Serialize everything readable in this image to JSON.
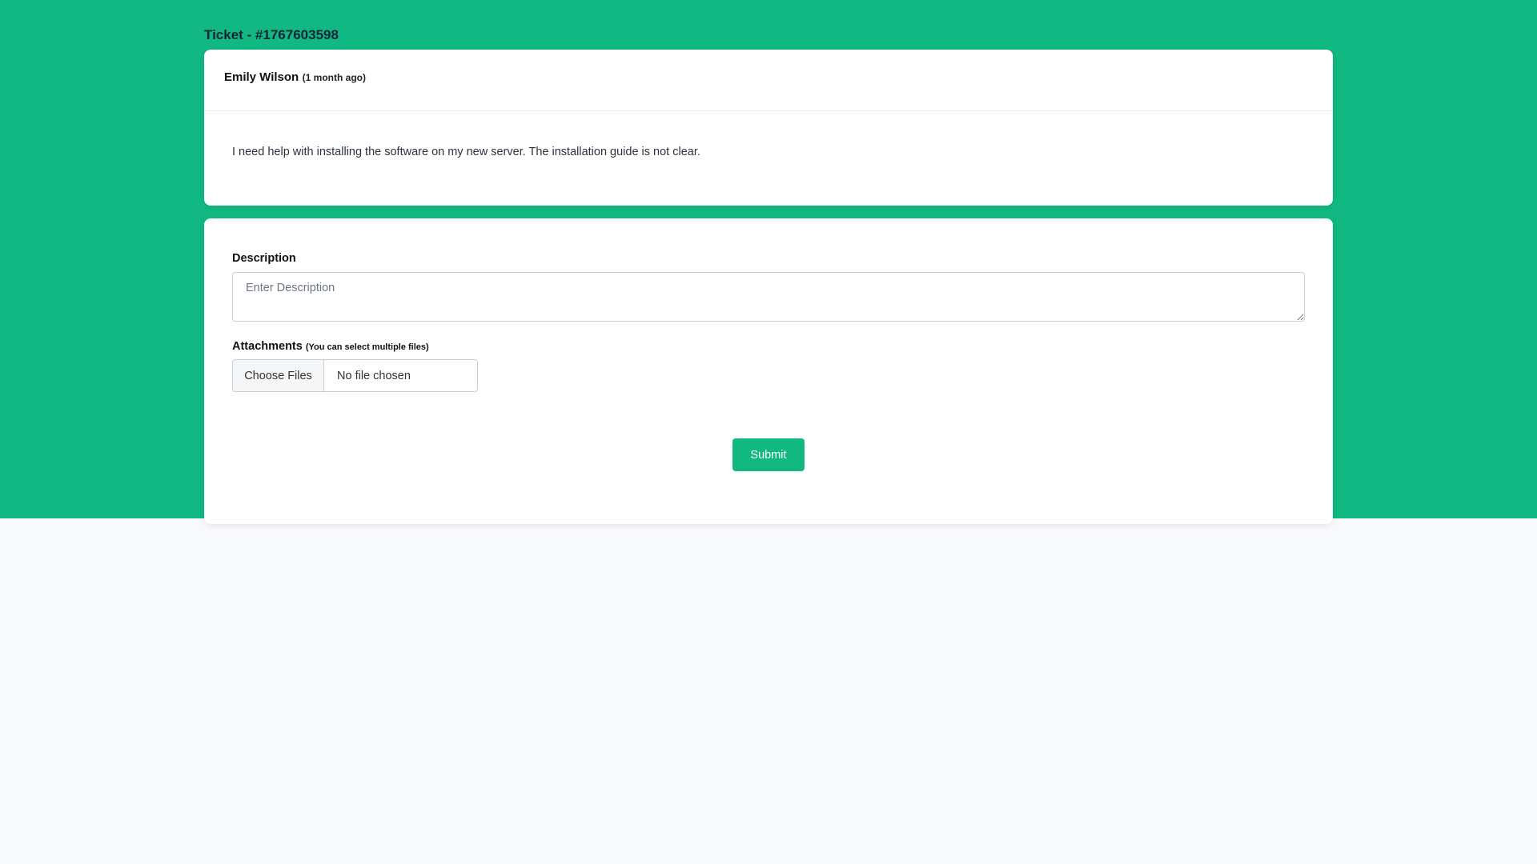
{
  "ticket": {
    "title": "Ticket - #1767603598"
  },
  "message": {
    "author": "Emily Wilson",
    "time_ago": "(1 month ago)",
    "body": "I need help with installing the software on my new server. The installation guide is not clear."
  },
  "form": {
    "description_label": "Description",
    "description_placeholder": "Enter Description",
    "attachments_label": "Attachments",
    "attachments_hint": "(You can select multiple files)",
    "choose_files_label": "Choose Files",
    "no_file_text": "No file chosen",
    "submit_label": "Submit"
  },
  "colors": {
    "accent": "#11b882",
    "page_bg": "#f8f9fb",
    "card_bg": "#ffffff"
  }
}
